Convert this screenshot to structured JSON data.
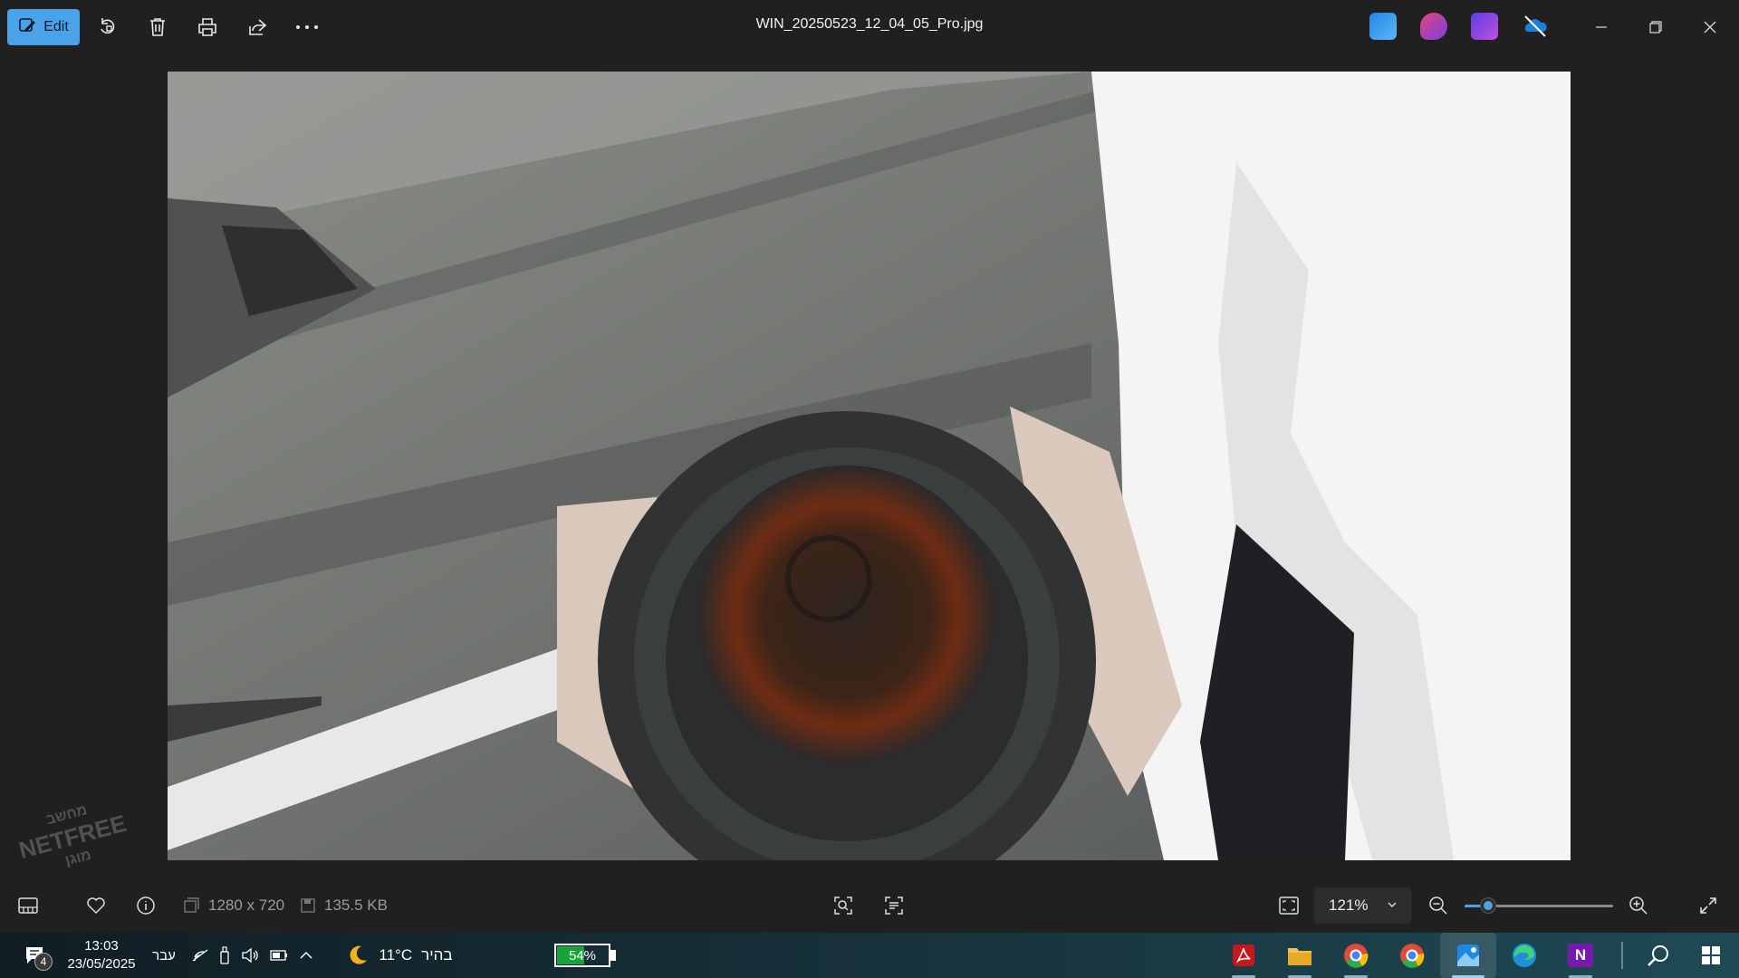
{
  "titlebar": {
    "edit_label": "Edit",
    "filename": "WIN_20250523_12_04_05_Pro.jpg",
    "accent_color": "#4aa3e8"
  },
  "photo": {
    "description_icon": "photo-content"
  },
  "statusbar": {
    "dimensions": "1280 x 720",
    "file_size": "135.5 KB",
    "zoom": "121%",
    "zoom_level_fraction": 0.16
  },
  "taskbar": {
    "notification_count": "4",
    "time": "13:03",
    "date": "23/05/2025",
    "language": "עבר",
    "temperature": "11°C",
    "weather": "בהיר",
    "battery": "54%",
    "battery_level": 0.54,
    "onenote_letter": "N"
  },
  "watermark": {
    "line1": "מחשב",
    "line2": "NETFREE",
    "line3": "מוגן"
  }
}
